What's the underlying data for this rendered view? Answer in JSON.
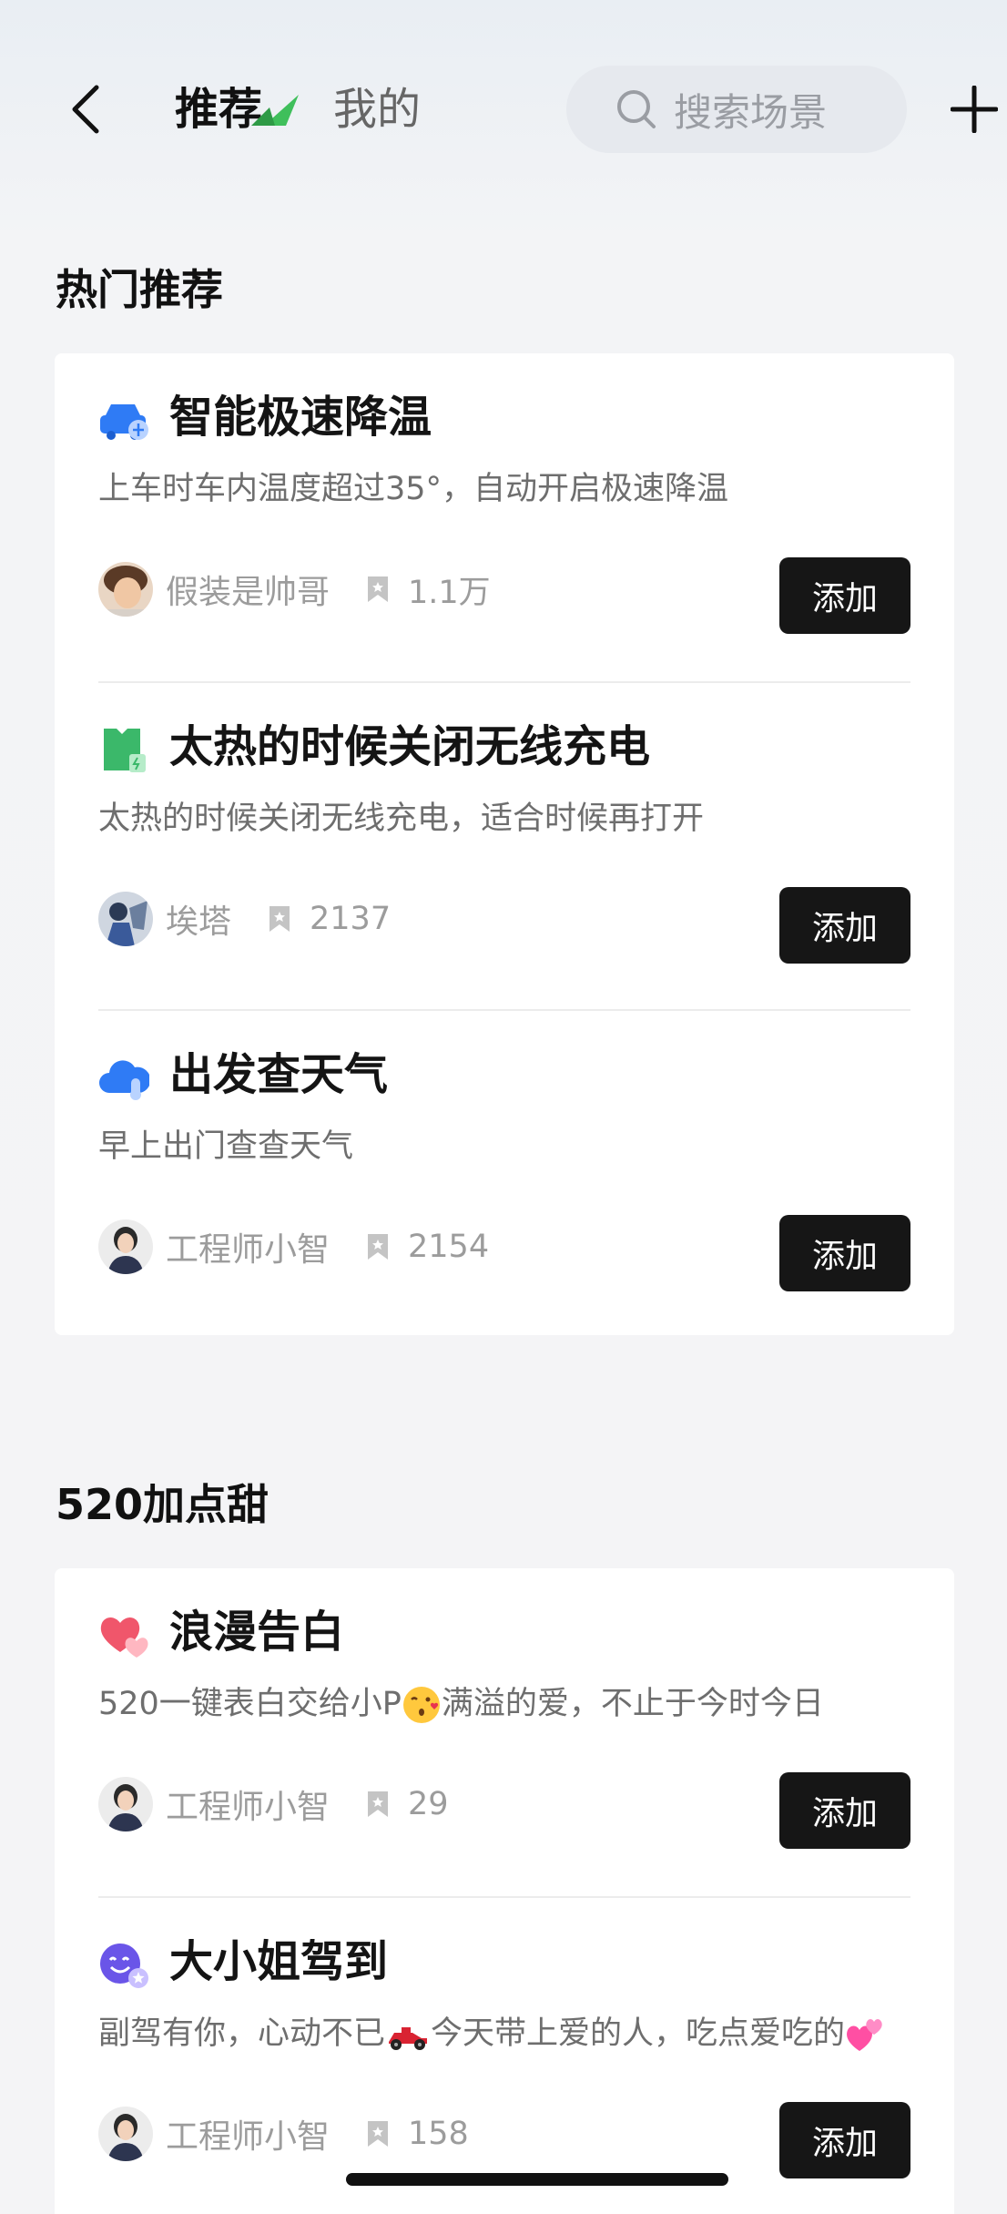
{
  "header": {
    "tab_recommend": "推荐",
    "tab_mine": "我的",
    "search_placeholder": "搜索场景"
  },
  "sections": [
    {
      "title": "热门推荐",
      "items": [
        {
          "icon": "car-cooling-icon",
          "title": "智能极速降温",
          "desc": "上车时车内温度超过35°，自动开启极速降温",
          "author": "假装是帅哥",
          "count": "1.1万",
          "button": "添加"
        },
        {
          "icon": "wireless-charge-icon",
          "title": "太热的时候关闭无线充电",
          "desc": "太热的时候关闭无线充电，适合时候再打开",
          "author": "埃塔",
          "count": "2137",
          "button": "添加"
        },
        {
          "icon": "weather-cloud-icon",
          "title": "出发查天气",
          "desc": "早上出门查查天气",
          "author": "工程师小智",
          "count": "2154",
          "button": "添加"
        }
      ]
    },
    {
      "title": "520加点甜",
      "items": [
        {
          "icon": "hearts-icon",
          "title": "浪漫告白",
          "desc_a": "520一键表白交给小P",
          "desc_b": "满溢的爱，不止于今时今日",
          "author": "工程师小智",
          "count": "29",
          "button": "添加"
        },
        {
          "icon": "smiley-star-icon",
          "title": "大小姐驾到",
          "desc_a": "副驾有你，心动不已",
          "desc_b": "今天带上爱的人，吃点爱吃的",
          "author": "工程师小智",
          "count": "158",
          "button": "添加"
        }
      ]
    }
  ],
  "colors": {
    "button_bg": "#161616",
    "accent_green": "#3fbf5b",
    "icon_blue": "#2f7bf5"
  }
}
